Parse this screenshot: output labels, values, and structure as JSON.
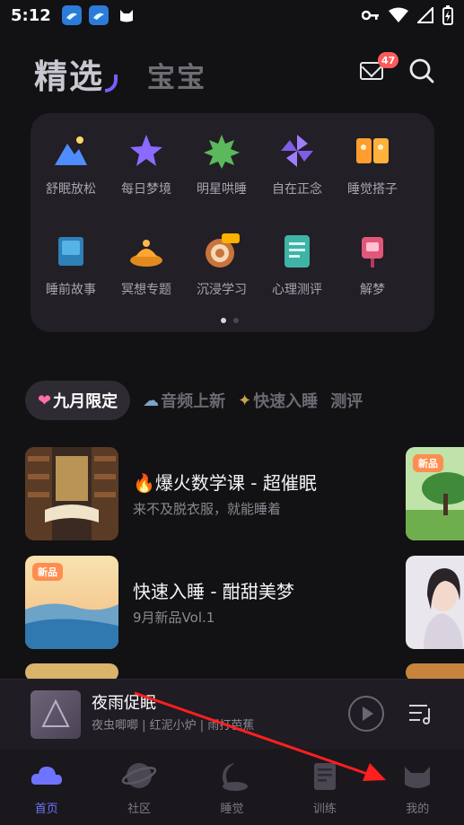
{
  "status_bar": {
    "time": "5:12"
  },
  "header": {
    "tab_selected": "精选",
    "tab_other": "宝宝",
    "mail_badge": "47"
  },
  "categories": [
    {
      "label": "舒眠放松",
      "icon": "mountain-icon"
    },
    {
      "label": "每日梦境",
      "icon": "star-cloud-icon"
    },
    {
      "label": "明星哄睡",
      "icon": "green-star-icon"
    },
    {
      "label": "自在正念",
      "icon": "pinwheel-icon"
    },
    {
      "label": "睡觉搭子",
      "icon": "cards-icon"
    },
    {
      "label": "睡前故事",
      "icon": "book-icon"
    },
    {
      "label": "冥想专题",
      "icon": "bowl-icon"
    },
    {
      "label": "沉浸学习",
      "icon": "target-icon",
      "tag": "课堂"
    },
    {
      "label": "心理测评",
      "icon": "document-icon"
    },
    {
      "label": "解梦",
      "icon": "mailbox-icon"
    }
  ],
  "chips": [
    {
      "label": "九月限定",
      "icon": "❤"
    },
    {
      "label": "音频上新",
      "icon": "☁"
    },
    {
      "label": "快速入睡",
      "icon": "✦"
    },
    {
      "label": "测评",
      "icon": ""
    }
  ],
  "list": [
    {
      "title": "🔥爆火数学课 - 超催眠",
      "subtitle": "来不及脱衣服，就能睡着"
    },
    {
      "title": "快速入睡 - 酣甜美梦",
      "subtitle": "9月新品Vol.1",
      "tag": "新品"
    }
  ],
  "peek_tag": "新品",
  "player": {
    "title": "夜雨促眠",
    "subtitle": "夜虫唧唧 | 红泥小炉 | 雨打芭蕉"
  },
  "tabs": [
    "首页",
    "社区",
    "睡觉",
    "训练",
    "我的"
  ],
  "colors": {
    "accent": "#6e74ff",
    "badge": "#ff5a5a",
    "new_tag": "#ff8d4e"
  }
}
